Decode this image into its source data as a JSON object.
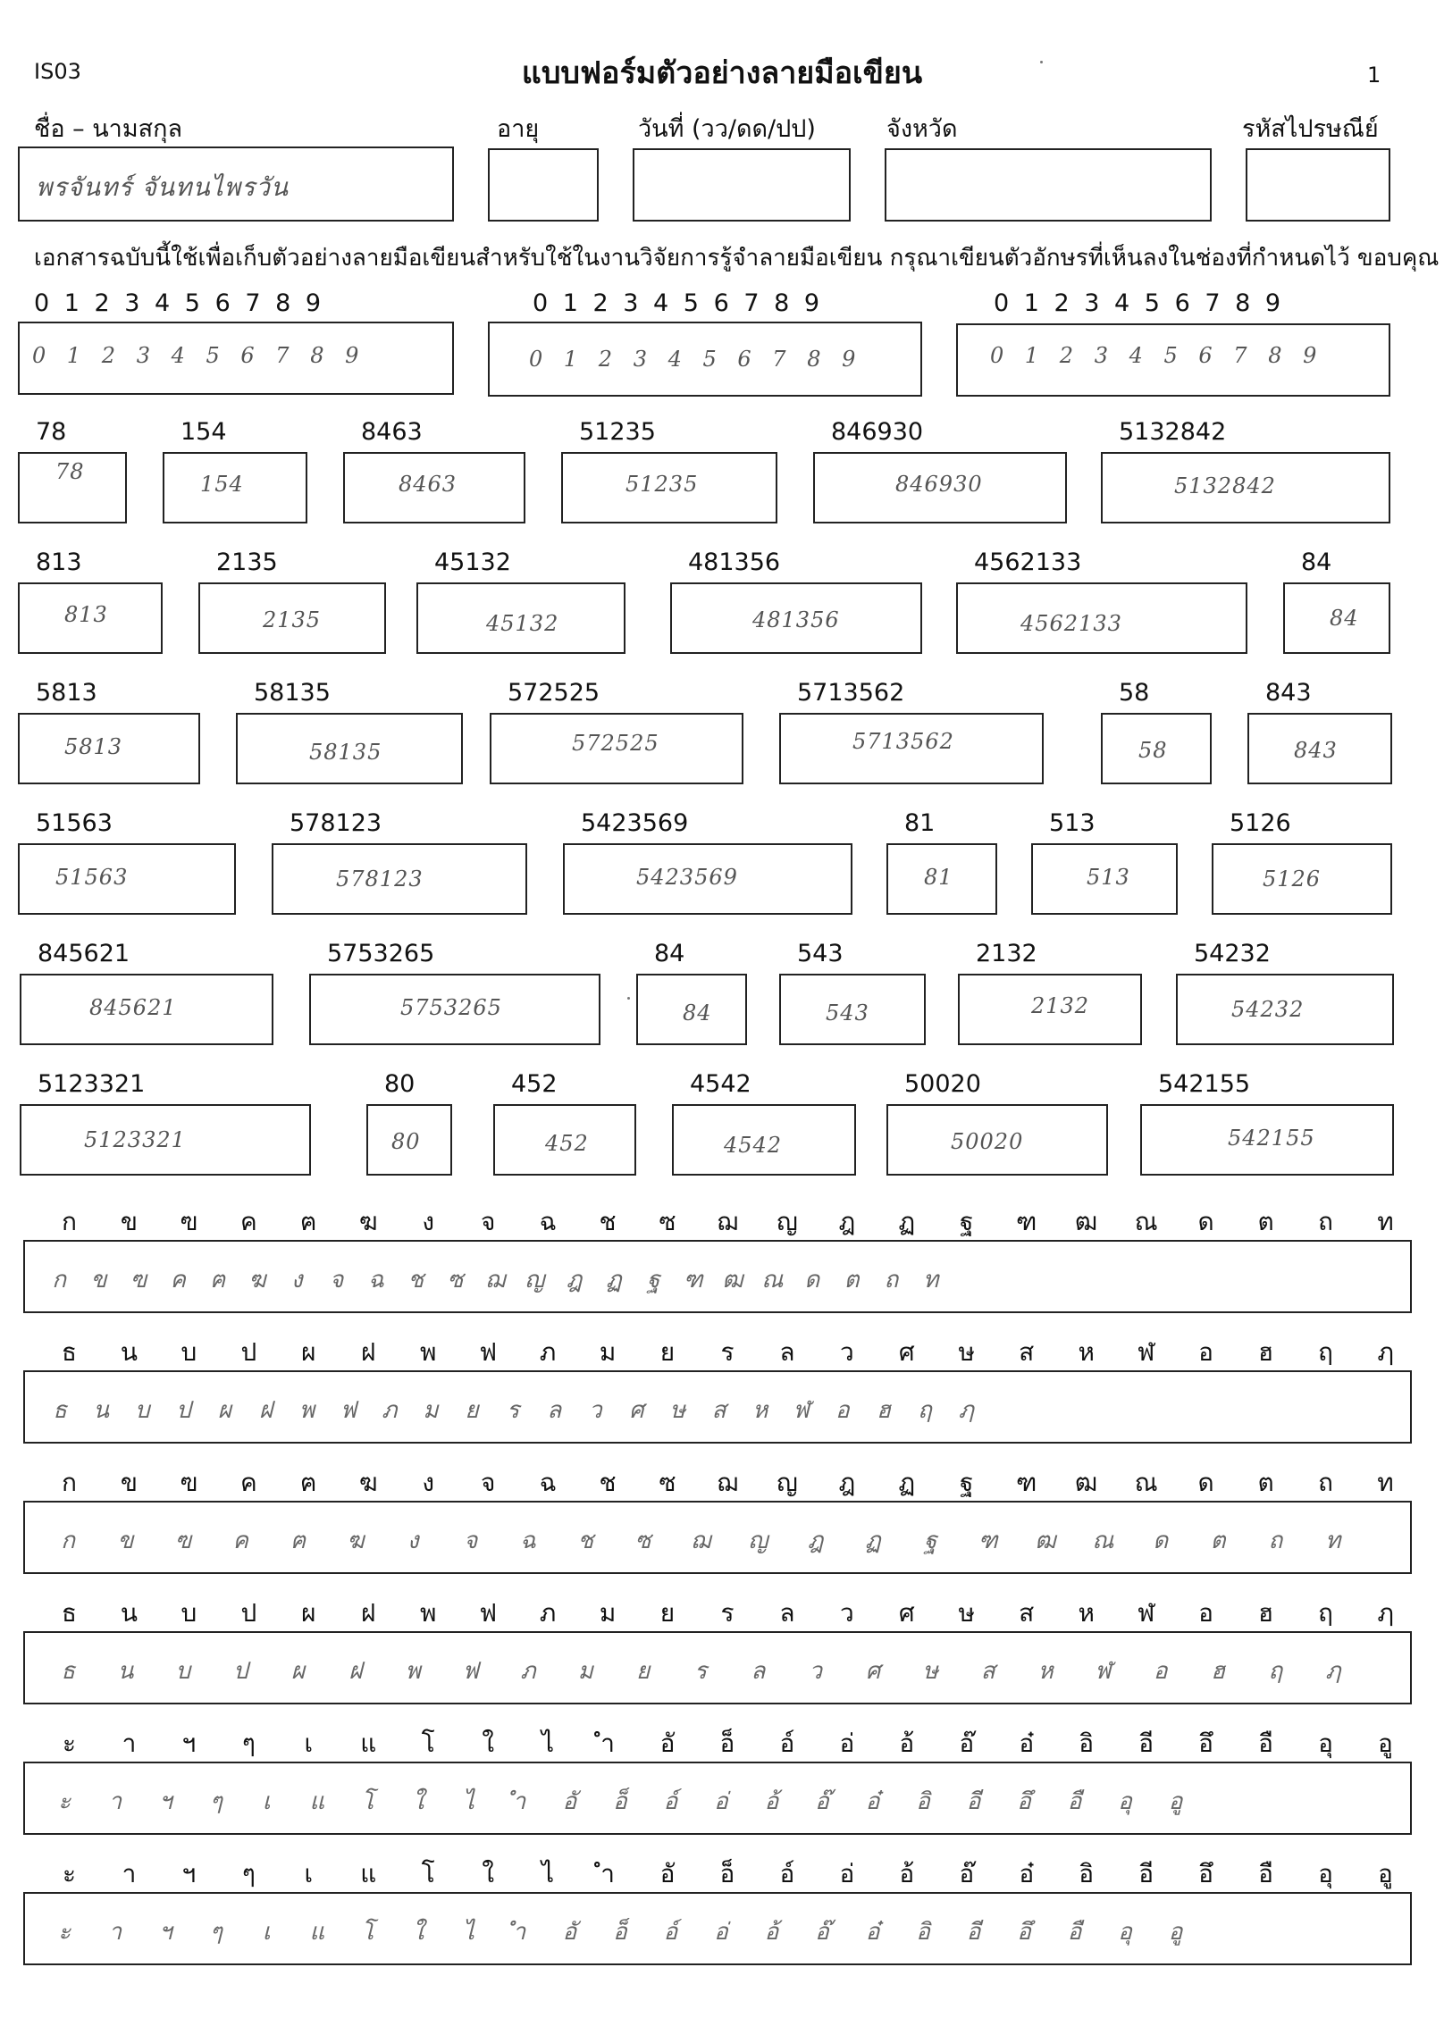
{
  "header": {
    "code": "IS03",
    "title": "แบบฟอร์มตัวอย่างลายมือเขียน",
    "page": "1"
  },
  "personal": {
    "name_label": "ชื่อ – นามสกุล",
    "age_label": "อายุ",
    "date_label": "วันที่ (วว/ดด/ปป)",
    "province_label": "จังหวัด",
    "postcode_label": "รหัสไปรษณีย์",
    "name_value": "พรจันทร์ จันทนไพรวัน",
    "age_value": "",
    "date_value": "",
    "province_value": "",
    "postcode_value": ""
  },
  "intro_text": "เอกสารฉบับนี้ใช้เพื่อเก็บตัวอย่างลายมือเขียนสำหรับใช้ในงานวิจัยการรู้จำลายมือเขียน กรุณาเขียนตัวอักษรที่เห็นลงในช่องที่กำหนดไว้ ขอบคุณ",
  "digit_prompts": [
    {
      "label": "0 1 2 3 4 5 6 7 8 9",
      "written": "0 1 2 3 4 5 6 7 8 9"
    },
    {
      "label": "0 1 2 3 4 5 6 7 8 9",
      "written": "0 1 2 3 4 5 6 7 8 9"
    },
    {
      "label": "0 1 2 3 4 5 6 7 8 9",
      "written": "0 1 2 3 4 5 6 7 8 9"
    }
  ],
  "number_rows": [
    [
      {
        "label": "78",
        "written": "78"
      },
      {
        "label": "154",
        "written": "154"
      },
      {
        "label": "8463",
        "written": "8463"
      },
      {
        "label": "51235",
        "written": "51235"
      },
      {
        "label": "846930",
        "written": "846930"
      },
      {
        "label": "5132842",
        "written": "5132842"
      }
    ],
    [
      {
        "label": "813",
        "written": "813"
      },
      {
        "label": "2135",
        "written": "2135"
      },
      {
        "label": "45132",
        "written": "45132"
      },
      {
        "label": "481356",
        "written": "481356"
      },
      {
        "label": "4562133",
        "written": "4562133"
      },
      {
        "label": "84",
        "written": "84"
      }
    ],
    [
      {
        "label": "5813",
        "written": "5813"
      },
      {
        "label": "58135",
        "written": "58135"
      },
      {
        "label": "572525",
        "written": "572525"
      },
      {
        "label": "5713562",
        "written": "5713562"
      },
      {
        "label": "58",
        "written": "58"
      },
      {
        "label": "843",
        "written": "843"
      }
    ],
    [
      {
        "label": "51563",
        "written": "51563"
      },
      {
        "label": "578123",
        "written": "578123"
      },
      {
        "label": "5423569",
        "written": "5423569"
      },
      {
        "label": "81",
        "written": "81"
      },
      {
        "label": "513",
        "written": "513"
      },
      {
        "label": "5126",
        "written": "5126"
      }
    ],
    [
      {
        "label": "845621",
        "written": "845621"
      },
      {
        "label": "5753265",
        "written": "5753265"
      },
      {
        "label": "84",
        "written": "84"
      },
      {
        "label": "543",
        "written": "543"
      },
      {
        "label": "2132",
        "written": "2132"
      },
      {
        "label": "54232",
        "written": "54232"
      }
    ],
    [
      {
        "label": "5123321",
        "written": "5123321"
      },
      {
        "label": "80",
        "written": "80"
      },
      {
        "label": "452",
        "written": "452"
      },
      {
        "label": "4542",
        "written": "4542"
      },
      {
        "label": "50020",
        "written": "50020"
      },
      {
        "label": "542155",
        "written": "542155"
      }
    ]
  ],
  "char_rows": [
    {
      "printed": [
        "ก",
        "ข",
        "ฃ",
        "ค",
        "ฅ",
        "ฆ",
        "ง",
        "จ",
        "ฉ",
        "ช",
        "ซ",
        "ฌ",
        "ญ",
        "ฎ",
        "ฏ",
        "ฐ",
        "ฑ",
        "ฒ",
        "ณ",
        "ด",
        "ต",
        "ถ",
        "ท"
      ],
      "written": [
        "ก",
        "ข",
        "ฃ",
        "ค",
        "ฅ",
        "ฆ",
        "ง",
        "จ",
        "ฉ",
        "ช",
        "ซ",
        "ฌ",
        "ญ",
        "ฎ",
        "ฏ",
        "ฐ",
        "ฑ",
        "ฒ",
        "ณ",
        "ด",
        "ต",
        "ถ",
        "ท"
      ]
    },
    {
      "printed": [
        "ธ",
        "น",
        "บ",
        "ป",
        "ผ",
        "ฝ",
        "พ",
        "ฟ",
        "ภ",
        "ม",
        "ย",
        "ร",
        "ล",
        "ว",
        "ศ",
        "ษ",
        "ส",
        "ห",
        "ฬ",
        "อ",
        "ฮ",
        "ฤ",
        "ฦ"
      ],
      "written": [
        "ธ",
        "น",
        "บ",
        "ป",
        "ผ",
        "ฝ",
        "พ",
        "ฟ",
        "ภ",
        "ม",
        "ย",
        "ร",
        "ล",
        "ว",
        "ศ",
        "ษ",
        "ส",
        "ห",
        "ฬ",
        "อ",
        "ฮ",
        "ฤ",
        "ฦ"
      ]
    },
    {
      "printed": [
        "ก",
        "ข",
        "ฃ",
        "ค",
        "ฅ",
        "ฆ",
        "ง",
        "จ",
        "ฉ",
        "ช",
        "ซ",
        "ฌ",
        "ญ",
        "ฎ",
        "ฏ",
        "ฐ",
        "ฑ",
        "ฒ",
        "ณ",
        "ด",
        "ต",
        "ถ",
        "ท"
      ],
      "written": [
        "ก",
        "ข",
        "ฃ",
        "ค",
        "ฅ",
        "ฆ",
        "ง",
        "จ",
        "ฉ",
        "ช",
        "ซ",
        "ฌ",
        "ญ",
        "ฎ",
        "ฏ",
        "ฐ",
        "ฑ",
        "ฒ",
        "ณ",
        "ด",
        "ต",
        "ถ",
        "ท"
      ]
    },
    {
      "printed": [
        "ธ",
        "น",
        "บ",
        "ป",
        "ผ",
        "ฝ",
        "พ",
        "ฟ",
        "ภ",
        "ม",
        "ย",
        "ร",
        "ล",
        "ว",
        "ศ",
        "ษ",
        "ส",
        "ห",
        "ฬ",
        "อ",
        "ฮ",
        "ฤ",
        "ฦ"
      ],
      "written": [
        "ธ",
        "น",
        "บ",
        "ป",
        "ผ",
        "ฝ",
        "พ",
        "ฟ",
        "ภ",
        "ม",
        "ย",
        "ร",
        "ล",
        "ว",
        "ศ",
        "ษ",
        "ส",
        "ห",
        "ฬ",
        "อ",
        "ฮ",
        "ฤ",
        "ฦ"
      ]
    },
    {
      "printed": [
        "ะ",
        "า",
        "ฯ",
        "ๆ",
        "เ",
        "แ",
        "โ",
        "ใ",
        "ไ",
        "ำ",
        "อั",
        "อ็",
        "อ์",
        "อ่",
        "อ้",
        "อ๊",
        "อ๋",
        "อิ",
        "อี",
        "อึ",
        "อื",
        "อุ",
        "อู"
      ],
      "written": [
        "ะ",
        "า",
        "ฯ",
        "ๆ",
        "เ",
        "แ",
        "โ",
        "ใ",
        "ไ",
        "ำ",
        "อั",
        "อ็",
        "อ์",
        "อ่",
        "อ้",
        "อ๊",
        "อ๋",
        "อิ",
        "อี",
        "อึ",
        "อื",
        "อุ",
        "อู"
      ]
    },
    {
      "printed": [
        "ะ",
        "า",
        "ฯ",
        "ๆ",
        "เ",
        "แ",
        "โ",
        "ใ",
        "ไ",
        "ำ",
        "อั",
        "อ็",
        "อ์",
        "อ่",
        "อ้",
        "อ๊",
        "อ๋",
        "อิ",
        "อี",
        "อึ",
        "อื",
        "อุ",
        "อู"
      ],
      "written": [
        "ะ",
        "า",
        "ฯ",
        "ๆ",
        "เ",
        "แ",
        "โ",
        "ใ",
        "ไ",
        "ำ",
        "อั",
        "อ็",
        "อ์",
        "อ่",
        "อ้",
        "อ๊",
        "อ๋",
        "อิ",
        "อี",
        "อึ",
        "อื",
        "อุ",
        "อู"
      ]
    }
  ]
}
